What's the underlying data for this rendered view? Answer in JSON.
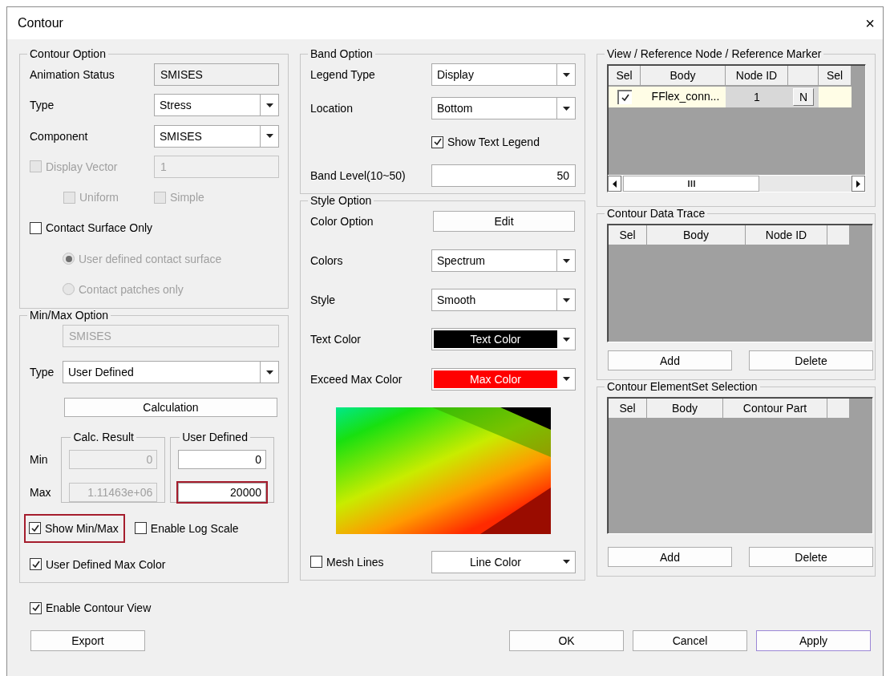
{
  "window": {
    "title": "Contour",
    "close": "×"
  },
  "contour_option": {
    "title": "Contour Option",
    "rows": [
      {
        "kind": "field",
        "label": "Animation Status",
        "value": "SMISES",
        "readonly": true
      },
      {
        "kind": "dropdown",
        "label": "Type",
        "value": "Stress"
      },
      {
        "kind": "dropdown",
        "label": "Component",
        "value": "SMISES"
      },
      {
        "kind": "check_field",
        "label": "Display Vector",
        "checked": false,
        "disabled": true,
        "value": "1"
      },
      {
        "kind": "check_pair",
        "items": [
          {
            "label": "Uniform",
            "checked": false,
            "disabled": true
          },
          {
            "label": "Simple",
            "checked": false,
            "disabled": true
          }
        ]
      },
      {
        "kind": "checkbox",
        "label": "Contact Surface Only",
        "checked": false,
        "disabled": false
      },
      {
        "kind": "radio",
        "label": "User defined contact surface",
        "selected": true,
        "disabled": true
      },
      {
        "kind": "radio",
        "label": "Contact patches only",
        "selected": false,
        "disabled": true
      }
    ]
  },
  "min_max_option": {
    "title": "Min/Max Option",
    "component": {
      "value": "SMISES",
      "disabled": true
    },
    "type": {
      "label": "Type",
      "value": "User Defined"
    },
    "calculate_button": "Calculation",
    "min_label": "Min",
    "max_label": "Max",
    "calc_result": {
      "title": "Calc. Result",
      "min": {
        "value": "0",
        "disabled": true,
        "highlighted": false
      },
      "max": {
        "value": "1.11463e+06",
        "disabled": true,
        "highlighted": false
      }
    },
    "user_defined": {
      "title": "User Defined",
      "min": {
        "value": "0",
        "disabled": false,
        "highlighted": false
      },
      "max": {
        "value": "20000",
        "disabled": false,
        "highlighted": true
      }
    },
    "checkbox_rows": [
      [
        {
          "label": "Show Min/Max",
          "checked": true,
          "highlighted": true
        },
        {
          "label": "Enable Log Scale",
          "checked": false,
          "highlighted": false
        }
      ],
      [
        {
          "label": "User Defined Max Color",
          "checked": true,
          "highlighted": false
        }
      ]
    ]
  },
  "band_option": {
    "title": "Band Option",
    "rows": [
      {
        "kind": "dropdown",
        "label": "Legend Type",
        "value": "Display"
      },
      {
        "kind": "dropdown",
        "label": "Location",
        "value": "Bottom"
      },
      {
        "kind": "control_checkbox",
        "label": "Show Text Legend",
        "checked": true,
        "disabled": false
      },
      {
        "kind": "number_field",
        "label": "Band Level(10~50)",
        "value": "50",
        "readonly": false
      }
    ]
  },
  "style_option": {
    "title": "Style Option",
    "rows": [
      {
        "kind": "button",
        "label": "Color Option",
        "text": "Edit"
      },
      {
        "kind": "dropdown",
        "label": "Colors",
        "value": "Spectrum"
      },
      {
        "kind": "dropdown",
        "label": "Style",
        "value": "Smooth"
      },
      {
        "kind": "color",
        "label": "Text Color",
        "value": "Text Color",
        "color": "#000000"
      },
      {
        "kind": "color",
        "label": "Exceed Max Color",
        "value": "Max Color",
        "color": "#ff0000"
      },
      {
        "kind": "preview"
      },
      {
        "kind": "check_color",
        "label": "Mesh Lines",
        "checked": false,
        "disabled": false,
        "value": "Line Color",
        "color": "#ffffff"
      }
    ]
  },
  "reference": {
    "title": "View / Reference Node / Reference Marker",
    "columns": [
      {
        "kind": "text",
        "label": "Sel"
      },
      {
        "kind": "text",
        "label": "Body"
      },
      {
        "kind": "text",
        "label": "Node ID"
      },
      {
        "kind": "blank"
      },
      {
        "kind": "text",
        "label": "Sel"
      }
    ],
    "rows": [
      {
        "checked": true,
        "body": "FFlex_conn...",
        "node_id": "1",
        "button": "N",
        "marker_checked": false
      }
    ]
  },
  "data_trace": {
    "title": "Contour Data Trace",
    "columns": [
      {
        "kind": "text",
        "label": "Sel"
      },
      {
        "kind": "text",
        "label": "Body"
      },
      {
        "kind": "text",
        "label": "Node ID"
      },
      {
        "kind": "blank"
      }
    ],
    "buttons": [
      "Add",
      "Delete"
    ]
  },
  "elementset": {
    "title": "Contour ElementSet Selection",
    "columns": [
      {
        "kind": "text",
        "label": "Sel"
      },
      {
        "kind": "text",
        "label": "Body"
      },
      {
        "kind": "text",
        "label": "Contour Part"
      },
      {
        "kind": "blank"
      }
    ],
    "buttons": [
      "Add",
      "Delete"
    ]
  },
  "footer": {
    "enable_contour_view": {
      "label": "Enable Contour View",
      "checked": true
    },
    "buttons": [
      {
        "label": "Export",
        "focused": false
      },
      {
        "label": "OK",
        "focused": false
      },
      {
        "label": "Cancel",
        "focused": false
      },
      {
        "label": "Apply",
        "focused": true
      }
    ]
  }
}
